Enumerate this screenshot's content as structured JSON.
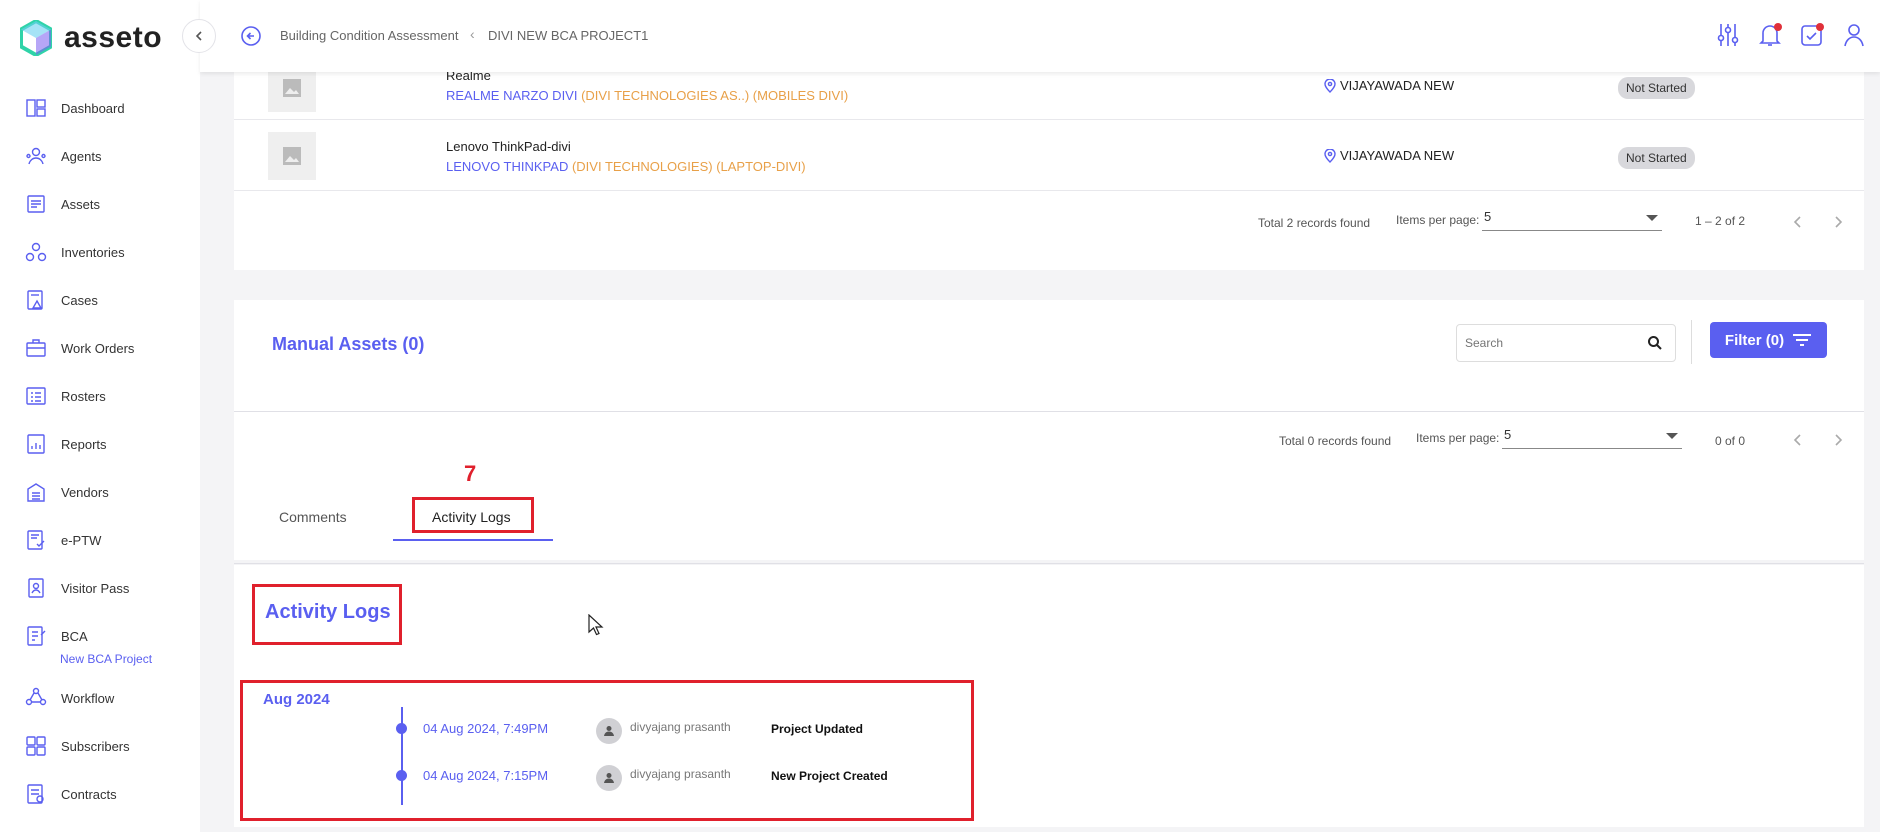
{
  "app": {
    "name": "asseto",
    "brand_color": "#5a5ff0",
    "annotation_color": "#e0202c"
  },
  "sidebar": {
    "items": [
      {
        "label": "Dashboard",
        "icon": "dashboard-icon"
      },
      {
        "label": "Agents",
        "icon": "agents-icon"
      },
      {
        "label": "Assets",
        "icon": "assets-icon"
      },
      {
        "label": "Inventories",
        "icon": "inventories-icon"
      },
      {
        "label": "Cases",
        "icon": "cases-icon"
      },
      {
        "label": "Work Orders",
        "icon": "work-orders-icon"
      },
      {
        "label": "Rosters",
        "icon": "rosters-icon"
      },
      {
        "label": "Reports",
        "icon": "reports-icon"
      },
      {
        "label": "Vendors",
        "icon": "vendors-icon"
      },
      {
        "label": "e-PTW",
        "icon": "eptw-icon"
      },
      {
        "label": "Visitor Pass",
        "icon": "visitor-pass-icon"
      },
      {
        "label": "BCA",
        "icon": "bca-icon"
      },
      {
        "label": "Workflow",
        "icon": "workflow-icon"
      },
      {
        "label": "Subscribers",
        "icon": "subscribers-icon"
      },
      {
        "label": "Contracts",
        "icon": "contracts-icon"
      }
    ],
    "bca_sub": "New BCA Project"
  },
  "header": {
    "breadcrumb": [
      "Building Condition Assessment",
      "DIVI NEW BCA PROJECT1"
    ],
    "icons": [
      "filter-settings-icon",
      "bell-icon",
      "calendar-check-icon",
      "user-icon"
    ]
  },
  "linked_assets": {
    "rows": [
      {
        "name": "Realme",
        "model": "REALME NARZO DIVI",
        "org": "(DIVI TECHNOLOGIES AS..)",
        "category": "(MOBILES DIVI)",
        "location": "VIJAYAWADA NEW",
        "status": "Not Started"
      },
      {
        "name": "Lenovo ThinkPad-divi",
        "model": "LENOVO THINKPAD",
        "org": "(DIVI TECHNOLOGIES)",
        "category": "(LAPTOP-DIVI)",
        "location": "VIJAYAWADA NEW",
        "status": "Not Started"
      }
    ],
    "pager": {
      "total": "Total 2 records found",
      "ipp_label": "Items per page:",
      "ipp_value": "5",
      "range": "1 – 2 of 2"
    }
  },
  "manual_assets": {
    "title": "Manual Assets (0)",
    "search_placeholder": "Search",
    "filter_label": "Filter (0)",
    "pager": {
      "total": "Total 0 records found",
      "ipp_label": "Items per page:",
      "ipp_value": "5",
      "range": "0 of 0"
    }
  },
  "tabs": {
    "items": [
      "Comments",
      "Activity Logs"
    ],
    "active": "Activity Logs",
    "annotation_number": "7"
  },
  "activity_logs": {
    "title": "Activity Logs",
    "month": "Aug 2024",
    "entries": [
      {
        "date": "04 Aug 2024, 7:49PM",
        "user": "divyajang prasanth",
        "event": "Project Updated"
      },
      {
        "date": "04 Aug 2024, 7:15PM",
        "user": "divyajang prasanth",
        "event": "New Project Created"
      }
    ]
  }
}
